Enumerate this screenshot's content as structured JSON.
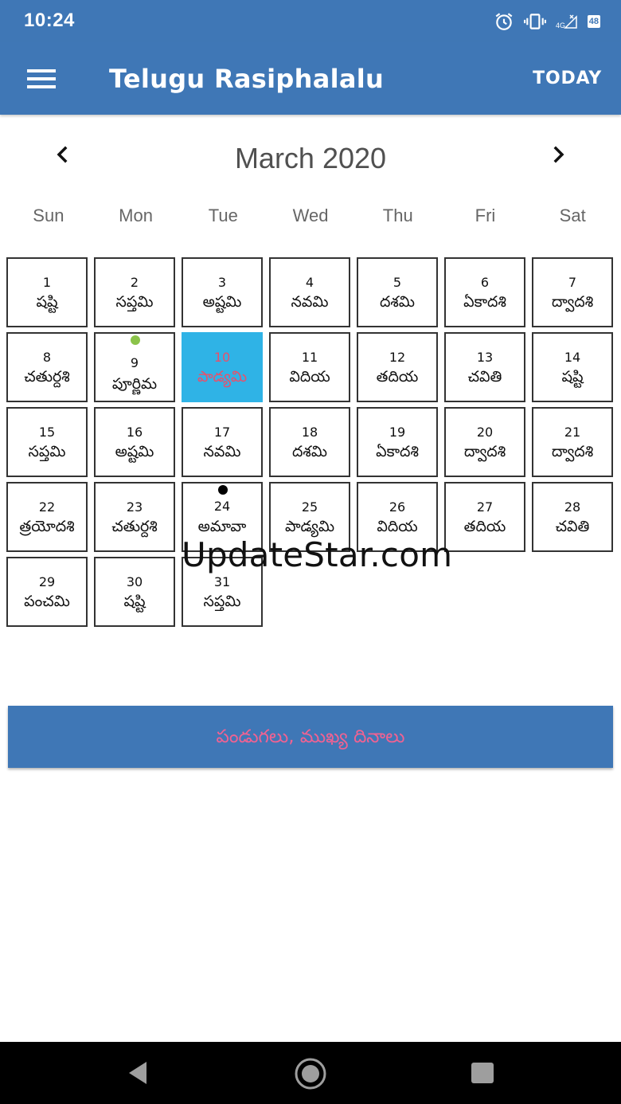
{
  "status": {
    "time": "10:24",
    "network": "4G",
    "battery": "48"
  },
  "app_bar": {
    "title": "Telugu Rasiphalalu",
    "today_label": "TODAY",
    "color": "#3f77b6"
  },
  "calendar": {
    "month_title": "March 2020",
    "weekdays": [
      "Sun",
      "Mon",
      "Tue",
      "Wed",
      "Thu",
      "Fri",
      "Sat"
    ],
    "selected_day": 10,
    "days": [
      {
        "num": "1",
        "tithi": "షష్టి"
      },
      {
        "num": "2",
        "tithi": "సప్తమి"
      },
      {
        "num": "3",
        "tithi": "అష్టమి"
      },
      {
        "num": "4",
        "tithi": "నవమి"
      },
      {
        "num": "5",
        "tithi": "దశమి"
      },
      {
        "num": "6",
        "tithi": "ఏకాదశి"
      },
      {
        "num": "7",
        "tithi": "ద్వాదశి"
      },
      {
        "num": "8",
        "tithi": "చతుర్దశి"
      },
      {
        "num": "9",
        "tithi": "పూర్ణిమ",
        "dot": "green"
      },
      {
        "num": "10",
        "tithi": "పాడ్యమి"
      },
      {
        "num": "11",
        "tithi": "విదియ"
      },
      {
        "num": "12",
        "tithi": "తదియ"
      },
      {
        "num": "13",
        "tithi": "చవితి"
      },
      {
        "num": "14",
        "tithi": "షష్టి"
      },
      {
        "num": "15",
        "tithi": "సప్తమి"
      },
      {
        "num": "16",
        "tithi": "అష్టమి"
      },
      {
        "num": "17",
        "tithi": "నవమి"
      },
      {
        "num": "18",
        "tithi": "దశమి"
      },
      {
        "num": "19",
        "tithi": "ఏకాదశి"
      },
      {
        "num": "20",
        "tithi": "ద్వాదశి"
      },
      {
        "num": "21",
        "tithi": "ద్వాదశి"
      },
      {
        "num": "22",
        "tithi": "త్రయోదశి"
      },
      {
        "num": "23",
        "tithi": "చతుర్దశి"
      },
      {
        "num": "24",
        "tithi": "అమావా",
        "dot": "black"
      },
      {
        "num": "25",
        "tithi": "పాడ్యమి"
      },
      {
        "num": "26",
        "tithi": "విదియ"
      },
      {
        "num": "27",
        "tithi": "తదియ"
      },
      {
        "num": "28",
        "tithi": "చవితి"
      },
      {
        "num": "29",
        "tithi": "పంచమి"
      },
      {
        "num": "30",
        "tithi": "షష్టి"
      },
      {
        "num": "31",
        "tithi": "సప్తమి"
      }
    ]
  },
  "watermark": "UpdateStar.com",
  "festivals_button": {
    "label": "పండుగలు, ముఖ్య దినాలు",
    "text_color": "#f06292"
  },
  "colors": {
    "selected_cell": "#2fb3e6",
    "selected_text": "#e8506b",
    "dot_green": "#8bc34a"
  }
}
